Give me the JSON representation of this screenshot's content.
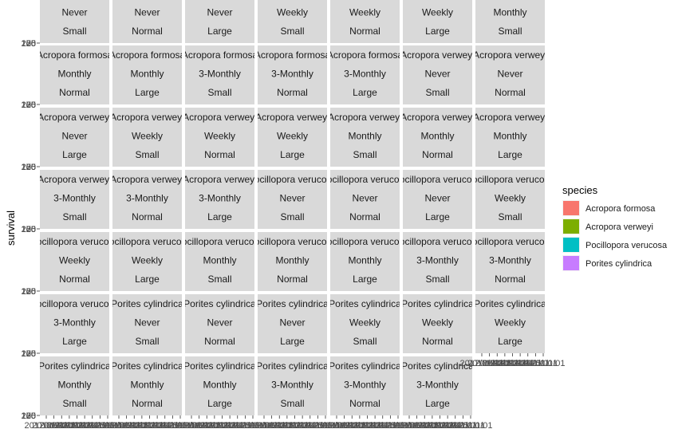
{
  "chart_data": {
    "type": "line",
    "facet_type": "wrap",
    "ylabel": "survival",
    "xlabel": "",
    "y_tick_labels": [
      "100",
      "125",
      "150",
      "175",
      "200"
    ],
    "x_tick_labels": [
      "2017/01/01",
      "2018/01/01",
      "2019/01/01",
      "2020/01/01",
      "2021/01/01",
      "2022/01/01",
      "2023/01/01",
      "2024/01/01",
      "2025/01/01"
    ],
    "panels": [
      [
        "Never",
        "Small"
      ],
      [
        "Never",
        "Normal"
      ],
      [
        "Never",
        "Large"
      ],
      [
        "Weekly",
        "Small"
      ],
      [
        "Weekly",
        "Normal"
      ],
      [
        "Weekly",
        "Large"
      ],
      [
        "Monthly",
        "Small"
      ],
      [
        "Acropora formosa",
        "Monthly",
        "Normal"
      ],
      [
        "Acropora formosa",
        "Monthly",
        "Large"
      ],
      [
        "Acropora formosa",
        "3-Monthly",
        "Small"
      ],
      [
        "Acropora formosa",
        "3-Monthly",
        "Normal"
      ],
      [
        "Acropora formosa",
        "3-Monthly",
        "Large"
      ],
      [
        "Acropora verweyi",
        "Never",
        "Small"
      ],
      [
        "Acropora verweyi",
        "Never",
        "Normal"
      ],
      [
        "Acropora verweyi",
        "Never",
        "Large"
      ],
      [
        "Acropora verweyi",
        "Weekly",
        "Small"
      ],
      [
        "Acropora verweyi",
        "Weekly",
        "Normal"
      ],
      [
        "Acropora verweyi",
        "Weekly",
        "Large"
      ],
      [
        "Acropora verweyi",
        "Monthly",
        "Small"
      ],
      [
        "Acropora verweyi",
        "Monthly",
        "Normal"
      ],
      [
        "Acropora verweyi",
        "Monthly",
        "Large"
      ],
      [
        "Acropora verweyi",
        "3-Monthly",
        "Small"
      ],
      [
        "Acropora verweyi",
        "3-Monthly",
        "Normal"
      ],
      [
        "Acropora verweyi",
        "3-Monthly",
        "Large"
      ],
      [
        "Pocillopora verucosa",
        "Never",
        "Small"
      ],
      [
        "Pocillopora verucosa",
        "Never",
        "Normal"
      ],
      [
        "Pocillopora verucosa",
        "Never",
        "Large"
      ],
      [
        "Pocillopora verucosa",
        "Weekly",
        "Small"
      ],
      [
        "Pocillopora verucosa",
        "Weekly",
        "Normal"
      ],
      [
        "Pocillopora verucosa",
        "Weekly",
        "Large"
      ],
      [
        "Pocillopora verucosa",
        "Monthly",
        "Small"
      ],
      [
        "Pocillopora verucosa",
        "Monthly",
        "Normal"
      ],
      [
        "Pocillopora verucosa",
        "Monthly",
        "Large"
      ],
      [
        "Pocillopora verucosa",
        "3-Monthly",
        "Small"
      ],
      [
        "Pocillopora verucosa",
        "3-Monthly",
        "Normal"
      ],
      [
        "Pocillopora verucosa",
        "3-Monthly",
        "Large"
      ],
      [
        "Porites cylindrica",
        "Never",
        "Small"
      ],
      [
        "Porites cylindrica",
        "Never",
        "Normal"
      ],
      [
        "Porites cylindrica",
        "Never",
        "Large"
      ],
      [
        "Porites cylindrica",
        "Weekly",
        "Small"
      ],
      [
        "Porites cylindrica",
        "Weekly",
        "Normal"
      ],
      [
        "Porites cylindrica",
        "Weekly",
        "Large"
      ],
      [
        "Porites cylindrica",
        "Monthly",
        "Small"
      ],
      [
        "Porites cylindrica",
        "Monthly",
        "Normal"
      ],
      [
        "Porites cylindrica",
        "Monthly",
        "Large"
      ],
      [
        "Porites cylindrica",
        "3-Monthly",
        "Small"
      ],
      [
        "Porites cylindrica",
        "3-Monthly",
        "Normal"
      ],
      [
        "Porites cylindrica",
        "3-Monthly",
        "Large"
      ]
    ],
    "legend": {
      "title": "species",
      "position": "right",
      "entries": [
        {
          "label": "Acropora formosa",
          "color": "#F8766D"
        },
        {
          "label": "Acropora verweyi",
          "color": "#7CAE00"
        },
        {
          "label": "Pocillopora verucosa",
          "color": "#00BFC4"
        },
        {
          "label": "Porites cylindrica",
          "color": "#C77CFF"
        }
      ]
    },
    "series": [],
    "grid": true,
    "colors": {
      "strip_background": "#D9D9D9",
      "panel_background": "#EBEBEB"
    }
  }
}
